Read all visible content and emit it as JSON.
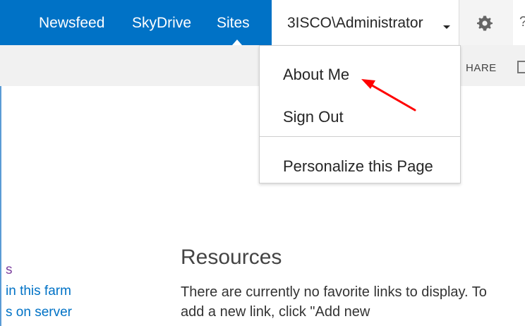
{
  "suite_bar": {
    "links": [
      "Newsfeed",
      "SkyDrive",
      "Sites"
    ],
    "user": "3ISCO\\Administrator",
    "help_glyph": "?",
    "colors": {
      "bar": "#0072c6"
    }
  },
  "ribbon": {
    "share": "HARE"
  },
  "user_dropdown": {
    "items": [
      "About Me",
      "Sign Out",
      "Personalize this Page"
    ],
    "annotation_color": "#ff0000"
  },
  "left_links": [
    "s",
    "in this farm",
    "s on server"
  ],
  "resources": {
    "title": "Resources",
    "text": "There are currently no favorite links to display. To add a new link, click \"Add new"
  },
  "icons": {
    "settings": "gear-icon",
    "help": "help-icon",
    "focus": "focus-on-content-icon",
    "caret": "chevron-down-icon"
  }
}
